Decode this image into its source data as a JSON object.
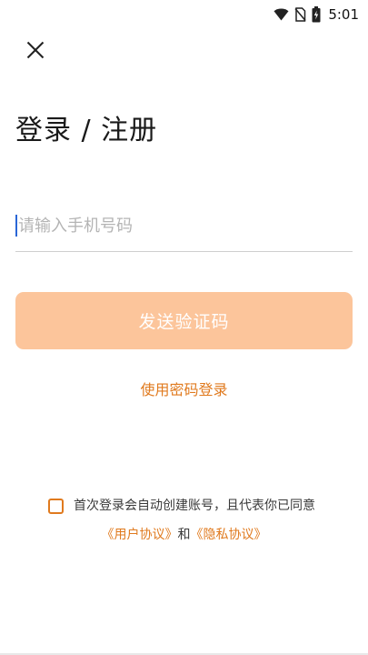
{
  "status_bar": {
    "time": "5:01",
    "icons": [
      "wifi-icon",
      "no-sim-icon",
      "battery-charging-icon"
    ]
  },
  "header": {
    "close_icon": "close-icon",
    "title": "登录 / 注册"
  },
  "form": {
    "phone_placeholder": "请输入手机号码",
    "phone_value": "",
    "send_code_label": "发送验证码",
    "password_login_label": "使用密码登录"
  },
  "agreement": {
    "checked": false,
    "text": "首次登录会自动创建账号，且代表你已同意",
    "user_agreement": "《用户协议》",
    "conjunction": "和",
    "privacy_agreement": "《隐私协议》"
  },
  "colors": {
    "accent": "#e07a1e",
    "button_disabled": "#fcc59b"
  }
}
